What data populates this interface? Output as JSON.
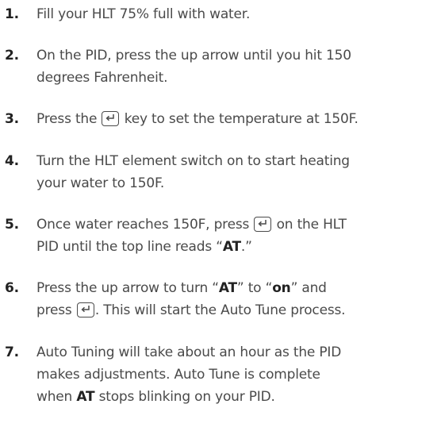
{
  "steps": [
    {
      "number": "1.",
      "text": "Fill your HLT 75% full with water."
    },
    {
      "number": "2.",
      "line1": "On the PID, press the up arrow until you hit 150",
      "line2": "degrees Fahrenheit."
    },
    {
      "number": "3.",
      "before": "Press the",
      "after": "key to set the temperature at 150F."
    },
    {
      "number": "4.",
      "line1": "Turn the HLT element switch on to start heating",
      "line2": "your water to 150F."
    },
    {
      "number": "5.",
      "before": "Once water reaches 150F, press",
      "after": "on the HLT",
      "line2_before": "PID until the top line reads “",
      "line2_bold": "AT",
      "line2_after": ".”"
    },
    {
      "number": "6.",
      "l1_a": "Press the up arrow to turn “",
      "l1_b1": "AT",
      "l1_c": "” to “",
      "l1_b2": "on",
      "l1_d": "” and",
      "l2_a": "press",
      "l2_b": ". This will start the Auto Tune process."
    },
    {
      "number": "7.",
      "line1": "Auto Tuning will take about an hour as the PID",
      "line2": "makes adjustments. Auto Tune is complete",
      "line3_a": "when",
      "line3_bold": "AT",
      "line3_b": "stops blinking on your PID."
    }
  ],
  "icons": {
    "enter_key": "enter-key-icon"
  }
}
